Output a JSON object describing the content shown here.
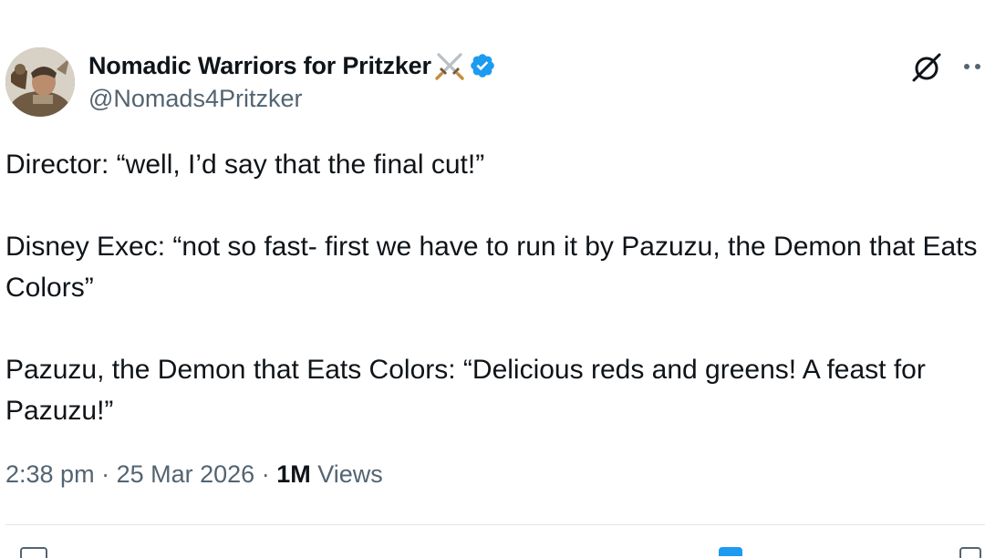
{
  "author": {
    "display_name": "Nomadic Warriors for Pritzker",
    "handle": "@Nomads4Pritzker",
    "name_emoji": "crossed-swords-icon",
    "verified_badge_color": "#1d9bf0"
  },
  "tweet": {
    "paragraphs": [
      "Director: “well, I’d say that the final cut!”",
      "Disney Exec: “not so fast- first we have to run it by Pazuzu, the Demon that Eats Colors”",
      "Pazuzu, the Demon that Eats Colors: “Delicious reds and greens! A feast for Pazuzu!”"
    ],
    "time": "2:38 pm",
    "separator": "·",
    "date": "25 Mar 2026",
    "views_count": "1M",
    "views_label": "Views"
  },
  "icons": {
    "grok": "grok-icon",
    "more": "more-icon"
  },
  "colors": {
    "text_primary": "#0f1419",
    "text_secondary": "#536471",
    "accent": "#1d9bf0",
    "divider": "#e1e6ea"
  }
}
